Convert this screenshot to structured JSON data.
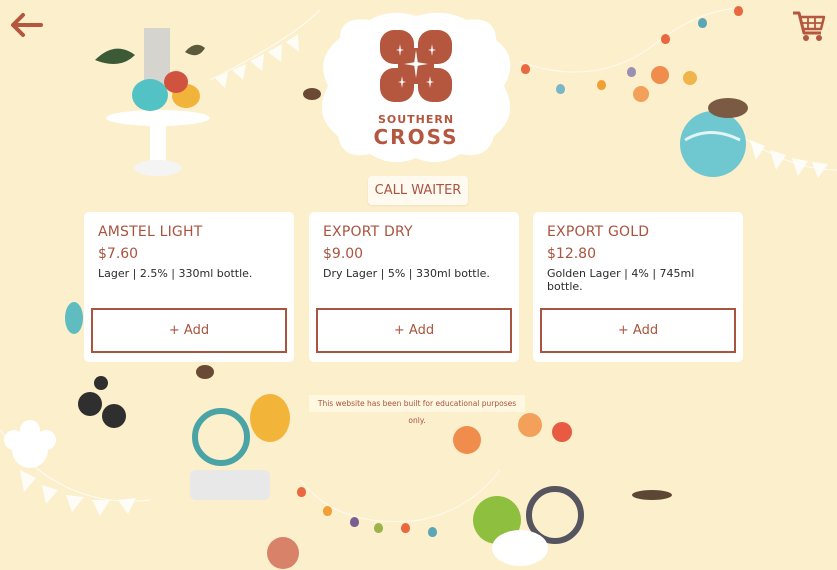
{
  "header": {
    "back_icon": "arrow-left-icon",
    "cart_icon": "shopping-cart-icon",
    "logo": {
      "line1": "SOUTHERN",
      "line2": "CROSS"
    },
    "call_waiter_label": "CALL WAITER"
  },
  "products": [
    {
      "name": "AMSTEL LIGHT",
      "price": "$7.60",
      "description": "Lager | 2.5% | 330ml bottle.",
      "add_label": "+ Add"
    },
    {
      "name": "EXPORT DRY",
      "price": "$9.00",
      "description": "Dry Lager | 5% | 330ml bottle.",
      "add_label": "+ Add"
    },
    {
      "name": "EXPORT GOLD",
      "price": "$12.80",
      "description": "Golden Lager | 4% | 745ml bottle.",
      "add_label": "+ Add"
    }
  ],
  "footer": {
    "notice": "This website has been built for educational purposes only."
  },
  "colors": {
    "background": "#fbefcc",
    "accent": "#a9543f",
    "card": "#ffffff"
  }
}
